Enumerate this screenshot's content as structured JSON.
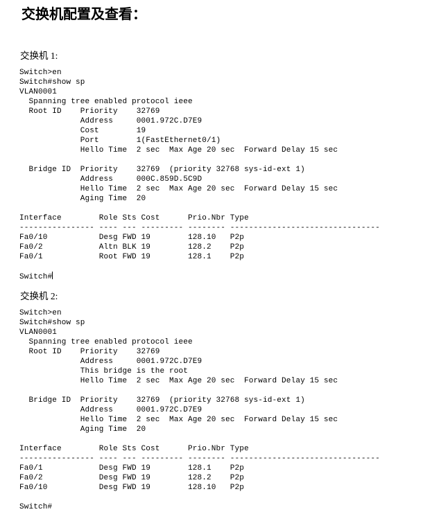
{
  "document": {
    "title": "交换机配置及查看："
  },
  "sections": [
    {
      "label": "交换机 1:",
      "terminal_lines": [
        "Switch>en",
        "Switch#show sp",
        "VLAN0001",
        "  Spanning tree enabled protocol ieee",
        "  Root ID    Priority    32769",
        "             Address     0001.972C.D7E9",
        "             Cost        19",
        "             Port        1(FastEthernet0/1)",
        "             Hello Time  2 sec  Max Age 20 sec  Forward Delay 15 sec",
        "",
        "  Bridge ID  Priority    32769  (priority 32768 sys-id-ext 1)",
        "             Address     000C.859D.5C9D",
        "             Hello Time  2 sec  Max Age 20 sec  Forward Delay 15 sec",
        "             Aging Time  20",
        "",
        "Interface        Role Sts Cost      Prio.Nbr Type",
        "---------------- ---- --- --------- -------- --------------------------------",
        "Fa0/10           Desg FWD 19        128.10   P2p",
        "Fa0/2            Altn BLK 19        128.2    P2p",
        "Fa0/1            Root FWD 19        128.1    P2p",
        "",
        "Switch#"
      ],
      "cursor_on_last_line": true
    },
    {
      "label": "交换机 2:",
      "terminal_lines": [
        "Switch>en",
        "Switch#show sp",
        "VLAN0001",
        "  Spanning tree enabled protocol ieee",
        "  Root ID    Priority    32769",
        "             Address     0001.972C.D7E9",
        "             This bridge is the root",
        "             Hello Time  2 sec  Max Age 20 sec  Forward Delay 15 sec",
        "",
        "  Bridge ID  Priority    32769  (priority 32768 sys-id-ext 1)",
        "             Address     0001.972C.D7E9",
        "             Hello Time  2 sec  Max Age 20 sec  Forward Delay 15 sec",
        "             Aging Time  20",
        "",
        "Interface        Role Sts Cost      Prio.Nbr Type",
        "---------------- ---- --- --------- -------- --------------------------------",
        "Fa0/1            Desg FWD 19        128.1    P2p",
        "Fa0/2            Desg FWD 19        128.2    P2p",
        "Fa0/10           Desg FWD 19        128.10   P2p",
        "",
        "Switch#"
      ],
      "cursor_on_last_line": false
    }
  ],
  "colors": {
    "background": "#ffffff",
    "text": "#000000"
  }
}
